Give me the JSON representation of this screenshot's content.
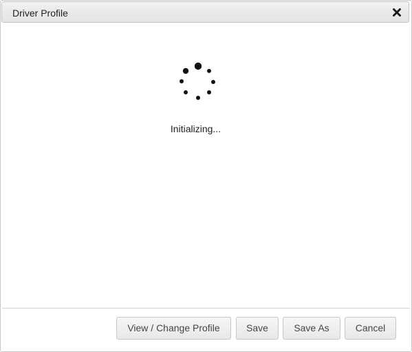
{
  "dialog": {
    "title": "Driver Profile",
    "close_icon": "close-icon"
  },
  "loading": {
    "status_text": "Initializing...",
    "spinner_icon": "loading-spinner-icon"
  },
  "footer": {
    "view_change_label": "View / Change Profile",
    "save_label": "Save",
    "save_as_label": "Save As",
    "cancel_label": "Cancel"
  }
}
